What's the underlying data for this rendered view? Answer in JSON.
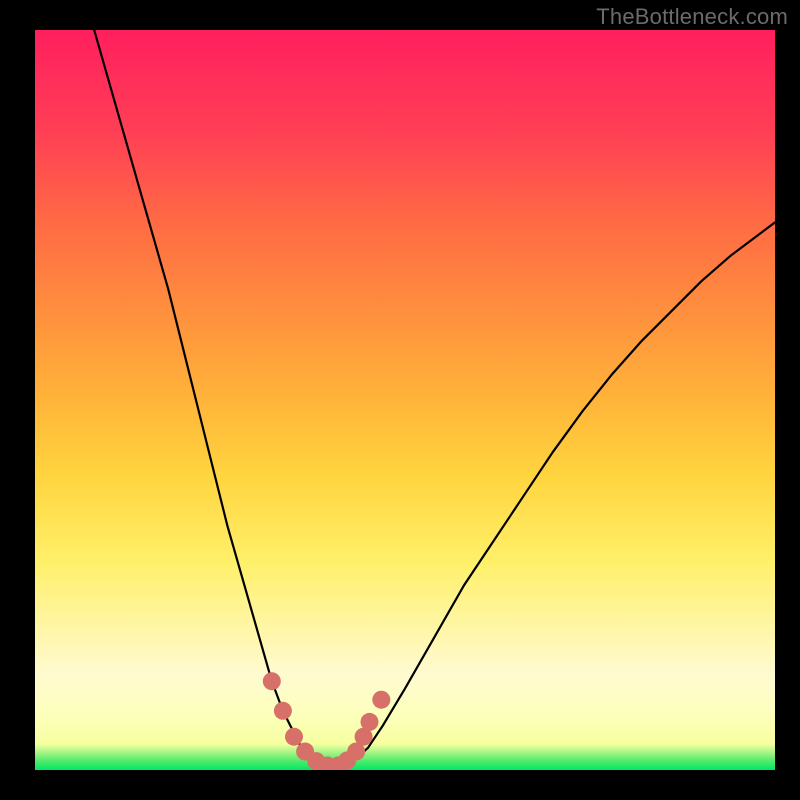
{
  "watermark": "TheBottleneck.com",
  "chart_data": {
    "type": "line",
    "title": "",
    "xlabel": "",
    "ylabel": "",
    "xlim": [
      0,
      100
    ],
    "ylim": [
      0,
      100
    ],
    "series": [
      {
        "name": "curve",
        "color": "#000000",
        "x": [
          8,
          10,
          12,
          14,
          16,
          18,
          20,
          22,
          24,
          26,
          28,
          30,
          32,
          33.5,
          35,
          36,
          37,
          38,
          39,
          40,
          41.5,
          43,
          45,
          47,
          50,
          54,
          58,
          62,
          66,
          70,
          74,
          78,
          82,
          86,
          90,
          94,
          98,
          100
        ],
        "y": [
          100,
          93,
          86,
          79,
          72,
          65,
          57,
          49,
          41,
          33,
          26,
          19,
          12,
          8,
          5,
          3,
          1.6,
          0.8,
          0.5,
          0.5,
          0.6,
          1.2,
          3,
          6,
          11,
          18,
          25,
          31,
          37,
          43,
          48.5,
          53.5,
          58,
          62,
          66,
          69.5,
          72.5,
          74
        ]
      },
      {
        "name": "markers",
        "color": "#d77069",
        "type": "scatter",
        "x": [
          32.0,
          33.5,
          35.0,
          36.5,
          38.0,
          39.5,
          41.0,
          42.2,
          43.4,
          44.4,
          45.2,
          46.8
        ],
        "y": [
          12.0,
          8.0,
          4.5,
          2.5,
          1.2,
          0.6,
          0.6,
          1.3,
          2.5,
          4.5,
          6.5,
          9.5
        ]
      }
    ]
  }
}
